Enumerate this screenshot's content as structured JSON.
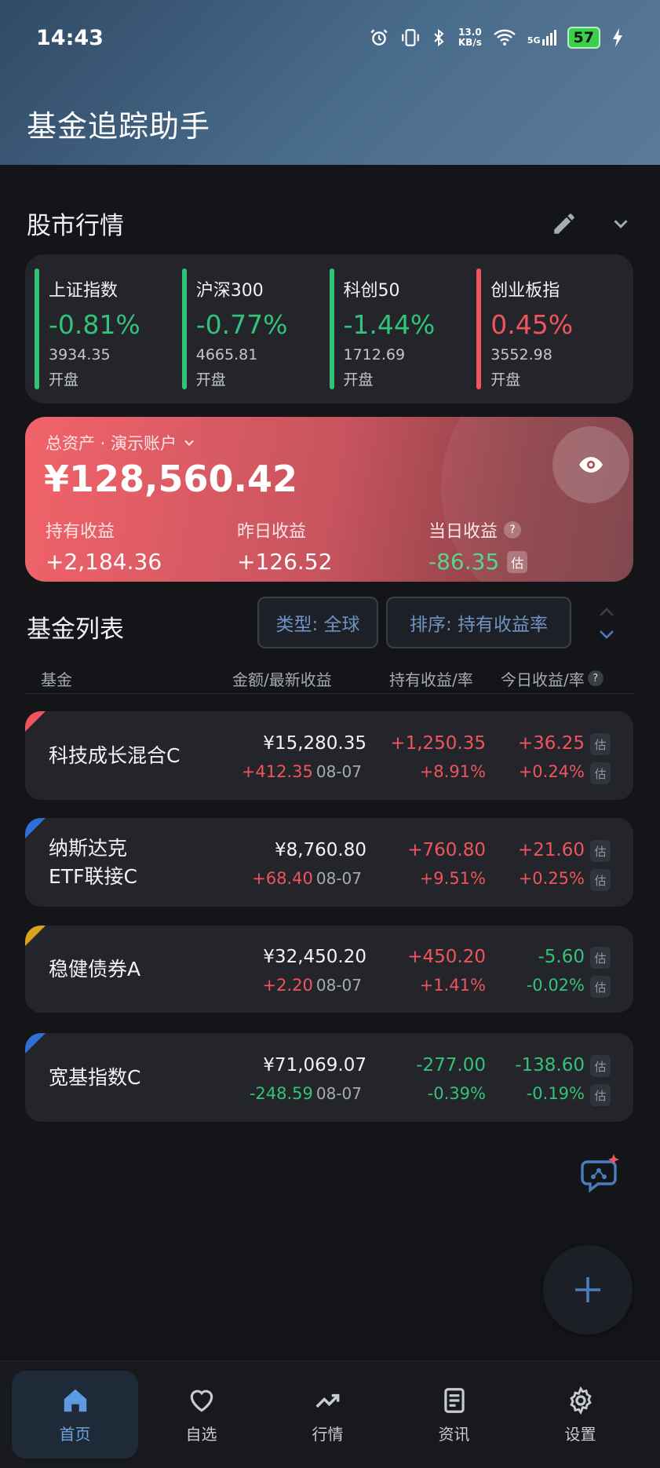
{
  "status_bar": {
    "time": "14:43",
    "net_speed_value": "13.0",
    "net_speed_unit": "KB/s",
    "signal_label": "5G",
    "battery": "57"
  },
  "app": {
    "title": "基金追踪助手"
  },
  "market": {
    "title": "股市行情",
    "indices": [
      {
        "name": "上证指数",
        "change": "-0.81%",
        "value": "3934.35",
        "state": "开盘",
        "trend": "down"
      },
      {
        "name": "沪深300",
        "change": "-0.77%",
        "value": "4665.81",
        "state": "开盘",
        "trend": "down"
      },
      {
        "name": "科创50",
        "change": "-1.44%",
        "value": "1712.69",
        "state": "开盘",
        "trend": "down"
      },
      {
        "name": "创业板指",
        "change": "0.45%",
        "value": "3552.98",
        "state": "开盘",
        "trend": "up"
      }
    ]
  },
  "asset": {
    "label": "总资产 · 演示账户",
    "total": "¥128,560.42",
    "holding_profit_label": "持有收益",
    "holding_profit": "+2,184.36",
    "yesterday_profit_label": "昨日收益",
    "yesterday_profit": "+126.52",
    "today_profit_label": "当日收益",
    "today_profit": "-86.35",
    "help_mark": "?",
    "estimate_badge": "估"
  },
  "fund_list": {
    "title": "基金列表",
    "type_filter": "类型: 全球",
    "sort_filter": "排序: 持有收益率",
    "columns": {
      "fund": "基金",
      "amount": "金额/最新收益",
      "holding": "持有收益/率",
      "today": "今日收益/率",
      "help_mark": "?"
    },
    "estimate_badge": "估",
    "funds": [
      {
        "name_line1": "科技成长混合C",
        "name_line2": "",
        "amount": "¥15,280.35",
        "latest_profit": "+412.35",
        "date": "08-07",
        "holding_profit": "+1,250.35",
        "holding_rate": "+8.91%",
        "today_profit": "+36.25",
        "today_rate": "+0.24%",
        "corner_color": "#f0545c"
      },
      {
        "name_line1": "纳斯达克",
        "name_line2": "ETF联接C",
        "amount": "¥8,760.80",
        "latest_profit": "+68.40",
        "date": "08-07",
        "holding_profit": "+760.80",
        "holding_rate": "+9.51%",
        "today_profit": "+21.60",
        "today_rate": "+0.25%",
        "corner_color": "#2f6fd6"
      },
      {
        "name_line1": "稳健债券A",
        "name_line2": "",
        "amount": "¥32,450.20",
        "latest_profit": "+2.20",
        "date": "08-07",
        "holding_profit": "+450.20",
        "holding_rate": "+1.41%",
        "today_profit": "-5.60",
        "today_rate": "-0.02%",
        "corner_color": "#d9a521"
      },
      {
        "name_line1": "宽基指数C",
        "name_line2": "",
        "amount": "¥71,069.07",
        "latest_profit": "-248.59",
        "date": "08-07",
        "holding_profit": "-277.00",
        "holding_rate": "-0.39%",
        "today_profit": "-138.60",
        "today_rate": "-0.19%",
        "corner_color": "#2f6fd6"
      }
    ]
  },
  "nav": {
    "items": [
      {
        "label": "首页",
        "icon": "home-icon"
      },
      {
        "label": "自选",
        "icon": "heart-icon"
      },
      {
        "label": "行情",
        "icon": "trend-icon"
      },
      {
        "label": "资讯",
        "icon": "news-icon"
      },
      {
        "label": "设置",
        "icon": "gear-icon"
      }
    ]
  },
  "colors": {
    "up": "#f0545c",
    "down": "#33c27a",
    "accent": "#6fa3e0"
  }
}
